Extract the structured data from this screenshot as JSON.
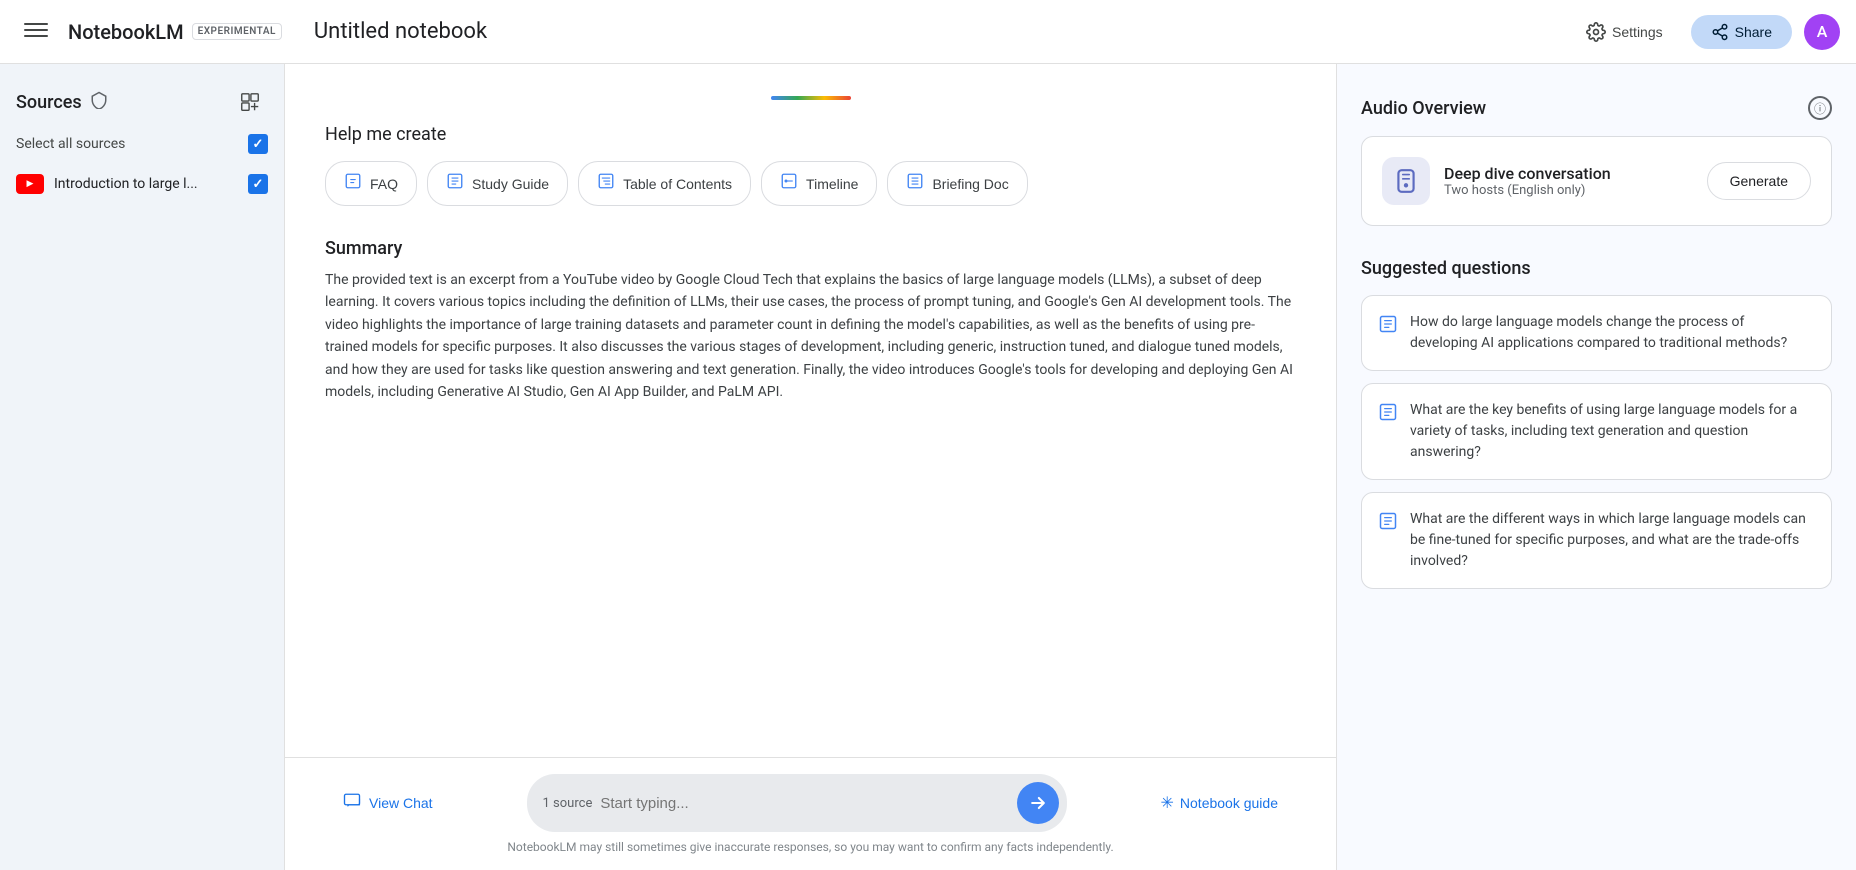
{
  "topbar": {
    "menu_icon": "☰",
    "brand_name": "NotebookLM",
    "brand_badge": "EXPERIMENTAL",
    "notebook_title": "Untitled notebook",
    "settings_label": "Settings",
    "share_label": "Share",
    "avatar_initial": "A"
  },
  "sidebar": {
    "title": "Sources",
    "select_all_label": "Select all sources",
    "add_icon": "+",
    "sources": [
      {
        "name": "Introduction to large l...",
        "type": "youtube"
      }
    ]
  },
  "help_me_create": {
    "title": "Help me create",
    "buttons": [
      {
        "label": "FAQ",
        "icon": "📋"
      },
      {
        "label": "Study Guide",
        "icon": "📖"
      },
      {
        "label": "Table of Contents",
        "icon": "📑"
      },
      {
        "label": "Timeline",
        "icon": "📅"
      },
      {
        "label": "Briefing Doc",
        "icon": "📄"
      }
    ]
  },
  "summary": {
    "title": "Summary",
    "text": "The provided text is an excerpt from a YouTube video by Google Cloud Tech that explains the basics of large language models (LLMs), a subset of deep learning. It covers various topics including the definition of LLMs, their use cases, the process of prompt tuning, and Google's Gen AI development tools. The video highlights the importance of large training datasets and parameter count in defining the model's capabilities, as well as the benefits of using pre-trained models for specific purposes. It also discusses the various stages of development, including generic, instruction tuned, and dialogue tuned models, and how they are used for tasks like question answering and text generation. Finally, the video introduces Google's tools for developing and deploying Gen AI models, including Generative AI Studio, Gen AI App Builder, and PaLM API."
  },
  "audio_overview": {
    "title": "Audio Overview",
    "card": {
      "icon": "🎙",
      "title": "Deep dive conversation",
      "subtitle": "Two hosts (English only)",
      "generate_label": "Generate"
    }
  },
  "suggested_questions": {
    "title": "Suggested questions",
    "questions": [
      "How do large language models change the process of developing AI applications compared to traditional methods?",
      "What are the key benefits of using large language models for a variety of tasks, including text generation and question answering?",
      "What are the different ways in which large language models can be fine-tuned for specific purposes, and what are the trade-offs involved?"
    ]
  },
  "bottom_bar": {
    "view_chat_label": "View Chat",
    "source_badge": "1 source",
    "search_placeholder": "Start typing...",
    "send_icon": "→",
    "notebook_guide_label": "Notebook guide",
    "disclaimer": "NotebookLM may still sometimes give inaccurate responses, so you may want to confirm any facts independently."
  }
}
